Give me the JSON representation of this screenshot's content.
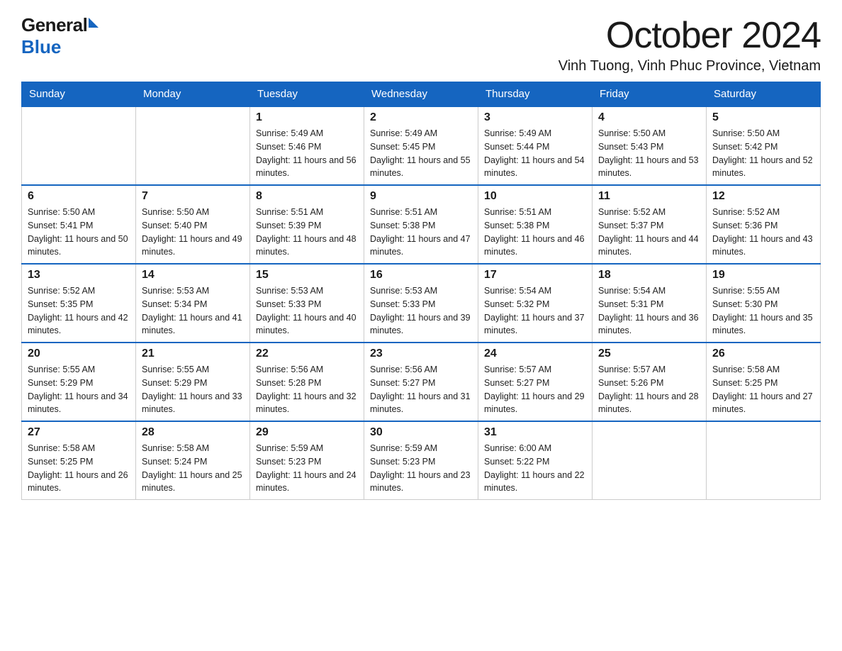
{
  "header": {
    "logo_general": "General",
    "logo_blue": "Blue",
    "month_title": "October 2024",
    "location": "Vinh Tuong, Vinh Phuc Province, Vietnam"
  },
  "days_of_week": [
    "Sunday",
    "Monday",
    "Tuesday",
    "Wednesday",
    "Thursday",
    "Friday",
    "Saturday"
  ],
  "weeks": [
    [
      {
        "day": "",
        "sunrise": "",
        "sunset": "",
        "daylight": ""
      },
      {
        "day": "",
        "sunrise": "",
        "sunset": "",
        "daylight": ""
      },
      {
        "day": "1",
        "sunrise": "Sunrise: 5:49 AM",
        "sunset": "Sunset: 5:46 PM",
        "daylight": "Daylight: 11 hours and 56 minutes."
      },
      {
        "day": "2",
        "sunrise": "Sunrise: 5:49 AM",
        "sunset": "Sunset: 5:45 PM",
        "daylight": "Daylight: 11 hours and 55 minutes."
      },
      {
        "day": "3",
        "sunrise": "Sunrise: 5:49 AM",
        "sunset": "Sunset: 5:44 PM",
        "daylight": "Daylight: 11 hours and 54 minutes."
      },
      {
        "day": "4",
        "sunrise": "Sunrise: 5:50 AM",
        "sunset": "Sunset: 5:43 PM",
        "daylight": "Daylight: 11 hours and 53 minutes."
      },
      {
        "day": "5",
        "sunrise": "Sunrise: 5:50 AM",
        "sunset": "Sunset: 5:42 PM",
        "daylight": "Daylight: 11 hours and 52 minutes."
      }
    ],
    [
      {
        "day": "6",
        "sunrise": "Sunrise: 5:50 AM",
        "sunset": "Sunset: 5:41 PM",
        "daylight": "Daylight: 11 hours and 50 minutes."
      },
      {
        "day": "7",
        "sunrise": "Sunrise: 5:50 AM",
        "sunset": "Sunset: 5:40 PM",
        "daylight": "Daylight: 11 hours and 49 minutes."
      },
      {
        "day": "8",
        "sunrise": "Sunrise: 5:51 AM",
        "sunset": "Sunset: 5:39 PM",
        "daylight": "Daylight: 11 hours and 48 minutes."
      },
      {
        "day": "9",
        "sunrise": "Sunrise: 5:51 AM",
        "sunset": "Sunset: 5:38 PM",
        "daylight": "Daylight: 11 hours and 47 minutes."
      },
      {
        "day": "10",
        "sunrise": "Sunrise: 5:51 AM",
        "sunset": "Sunset: 5:38 PM",
        "daylight": "Daylight: 11 hours and 46 minutes."
      },
      {
        "day": "11",
        "sunrise": "Sunrise: 5:52 AM",
        "sunset": "Sunset: 5:37 PM",
        "daylight": "Daylight: 11 hours and 44 minutes."
      },
      {
        "day": "12",
        "sunrise": "Sunrise: 5:52 AM",
        "sunset": "Sunset: 5:36 PM",
        "daylight": "Daylight: 11 hours and 43 minutes."
      }
    ],
    [
      {
        "day": "13",
        "sunrise": "Sunrise: 5:52 AM",
        "sunset": "Sunset: 5:35 PM",
        "daylight": "Daylight: 11 hours and 42 minutes."
      },
      {
        "day": "14",
        "sunrise": "Sunrise: 5:53 AM",
        "sunset": "Sunset: 5:34 PM",
        "daylight": "Daylight: 11 hours and 41 minutes."
      },
      {
        "day": "15",
        "sunrise": "Sunrise: 5:53 AM",
        "sunset": "Sunset: 5:33 PM",
        "daylight": "Daylight: 11 hours and 40 minutes."
      },
      {
        "day": "16",
        "sunrise": "Sunrise: 5:53 AM",
        "sunset": "Sunset: 5:33 PM",
        "daylight": "Daylight: 11 hours and 39 minutes."
      },
      {
        "day": "17",
        "sunrise": "Sunrise: 5:54 AM",
        "sunset": "Sunset: 5:32 PM",
        "daylight": "Daylight: 11 hours and 37 minutes."
      },
      {
        "day": "18",
        "sunrise": "Sunrise: 5:54 AM",
        "sunset": "Sunset: 5:31 PM",
        "daylight": "Daylight: 11 hours and 36 minutes."
      },
      {
        "day": "19",
        "sunrise": "Sunrise: 5:55 AM",
        "sunset": "Sunset: 5:30 PM",
        "daylight": "Daylight: 11 hours and 35 minutes."
      }
    ],
    [
      {
        "day": "20",
        "sunrise": "Sunrise: 5:55 AM",
        "sunset": "Sunset: 5:29 PM",
        "daylight": "Daylight: 11 hours and 34 minutes."
      },
      {
        "day": "21",
        "sunrise": "Sunrise: 5:55 AM",
        "sunset": "Sunset: 5:29 PM",
        "daylight": "Daylight: 11 hours and 33 minutes."
      },
      {
        "day": "22",
        "sunrise": "Sunrise: 5:56 AM",
        "sunset": "Sunset: 5:28 PM",
        "daylight": "Daylight: 11 hours and 32 minutes."
      },
      {
        "day": "23",
        "sunrise": "Sunrise: 5:56 AM",
        "sunset": "Sunset: 5:27 PM",
        "daylight": "Daylight: 11 hours and 31 minutes."
      },
      {
        "day": "24",
        "sunrise": "Sunrise: 5:57 AM",
        "sunset": "Sunset: 5:27 PM",
        "daylight": "Daylight: 11 hours and 29 minutes."
      },
      {
        "day": "25",
        "sunrise": "Sunrise: 5:57 AM",
        "sunset": "Sunset: 5:26 PM",
        "daylight": "Daylight: 11 hours and 28 minutes."
      },
      {
        "day": "26",
        "sunrise": "Sunrise: 5:58 AM",
        "sunset": "Sunset: 5:25 PM",
        "daylight": "Daylight: 11 hours and 27 minutes."
      }
    ],
    [
      {
        "day": "27",
        "sunrise": "Sunrise: 5:58 AM",
        "sunset": "Sunset: 5:25 PM",
        "daylight": "Daylight: 11 hours and 26 minutes."
      },
      {
        "day": "28",
        "sunrise": "Sunrise: 5:58 AM",
        "sunset": "Sunset: 5:24 PM",
        "daylight": "Daylight: 11 hours and 25 minutes."
      },
      {
        "day": "29",
        "sunrise": "Sunrise: 5:59 AM",
        "sunset": "Sunset: 5:23 PM",
        "daylight": "Daylight: 11 hours and 24 minutes."
      },
      {
        "day": "30",
        "sunrise": "Sunrise: 5:59 AM",
        "sunset": "Sunset: 5:23 PM",
        "daylight": "Daylight: 11 hours and 23 minutes."
      },
      {
        "day": "31",
        "sunrise": "Sunrise: 6:00 AM",
        "sunset": "Sunset: 5:22 PM",
        "daylight": "Daylight: 11 hours and 22 minutes."
      },
      {
        "day": "",
        "sunrise": "",
        "sunset": "",
        "daylight": ""
      },
      {
        "day": "",
        "sunrise": "",
        "sunset": "",
        "daylight": ""
      }
    ]
  ]
}
